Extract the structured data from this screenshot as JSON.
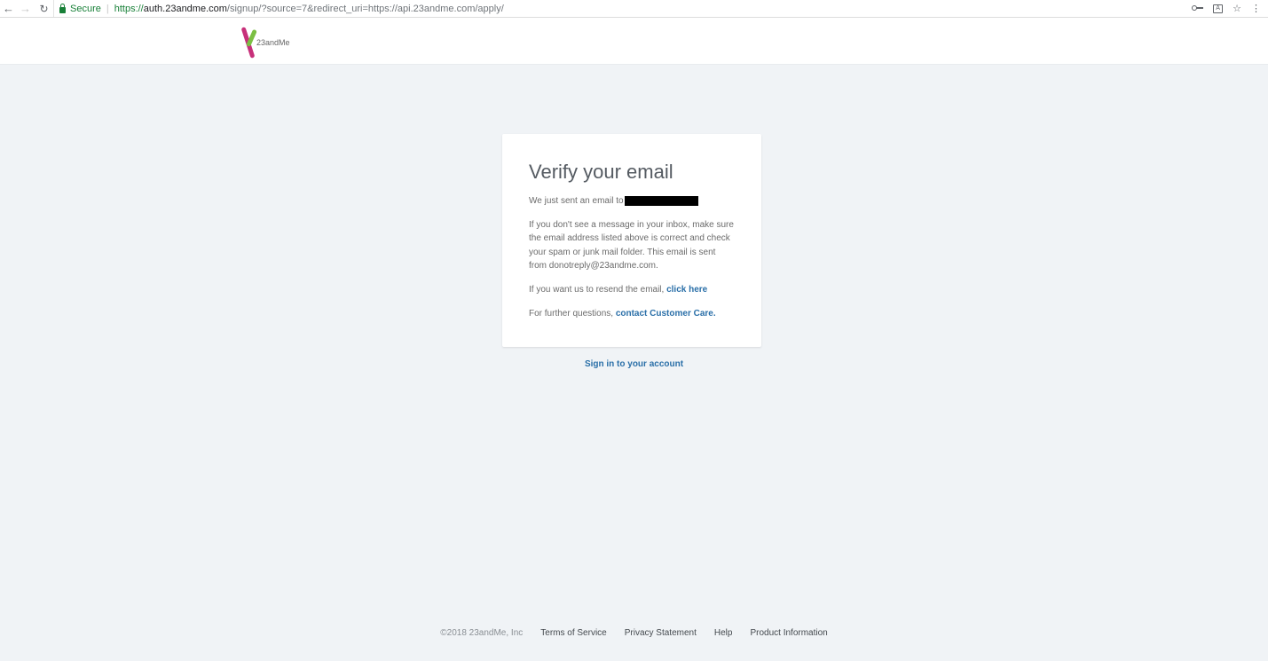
{
  "browser": {
    "back_icon": "arrow-left-icon",
    "forward_icon": "arrow-right-icon",
    "reload_icon": "reload-icon",
    "secure_label": "Secure",
    "url_scheme": "https://",
    "url_host": "auth.23andme.com",
    "url_path": "/signup/?source=7&redirect_uri=https://api.23andme.com/apply/",
    "right_icons": [
      "key-icon",
      "translate-icon",
      "star-icon",
      "menu-dots-icon"
    ]
  },
  "header": {
    "logo_text": "23andMe"
  },
  "card": {
    "title": "Verify your email",
    "sent_prefix": "We just sent an email to",
    "inbox_help": "If you don't see a message in your inbox, make sure the email address listed above is correct and check your spam or junk mail folder. This email is sent from donotreply@23andme.com.",
    "resend_prefix": "If you want us to resend the email, ",
    "resend_link": "click here",
    "questions_prefix": "For further questions, ",
    "questions_link": "contact Customer Care",
    "questions_suffix": "."
  },
  "signin_link": "Sign in to your account",
  "footer": {
    "copyright": "©2018 23andMe, Inc",
    "links": [
      "Terms of Service",
      "Privacy Statement",
      "Help",
      "Product Information"
    ]
  },
  "colors": {
    "page_bg": "#f0f3f6",
    "link": "#2a6fa8",
    "secure_green": "#188038",
    "logo_pink": "#c7307a",
    "logo_green": "#7bbf43"
  }
}
